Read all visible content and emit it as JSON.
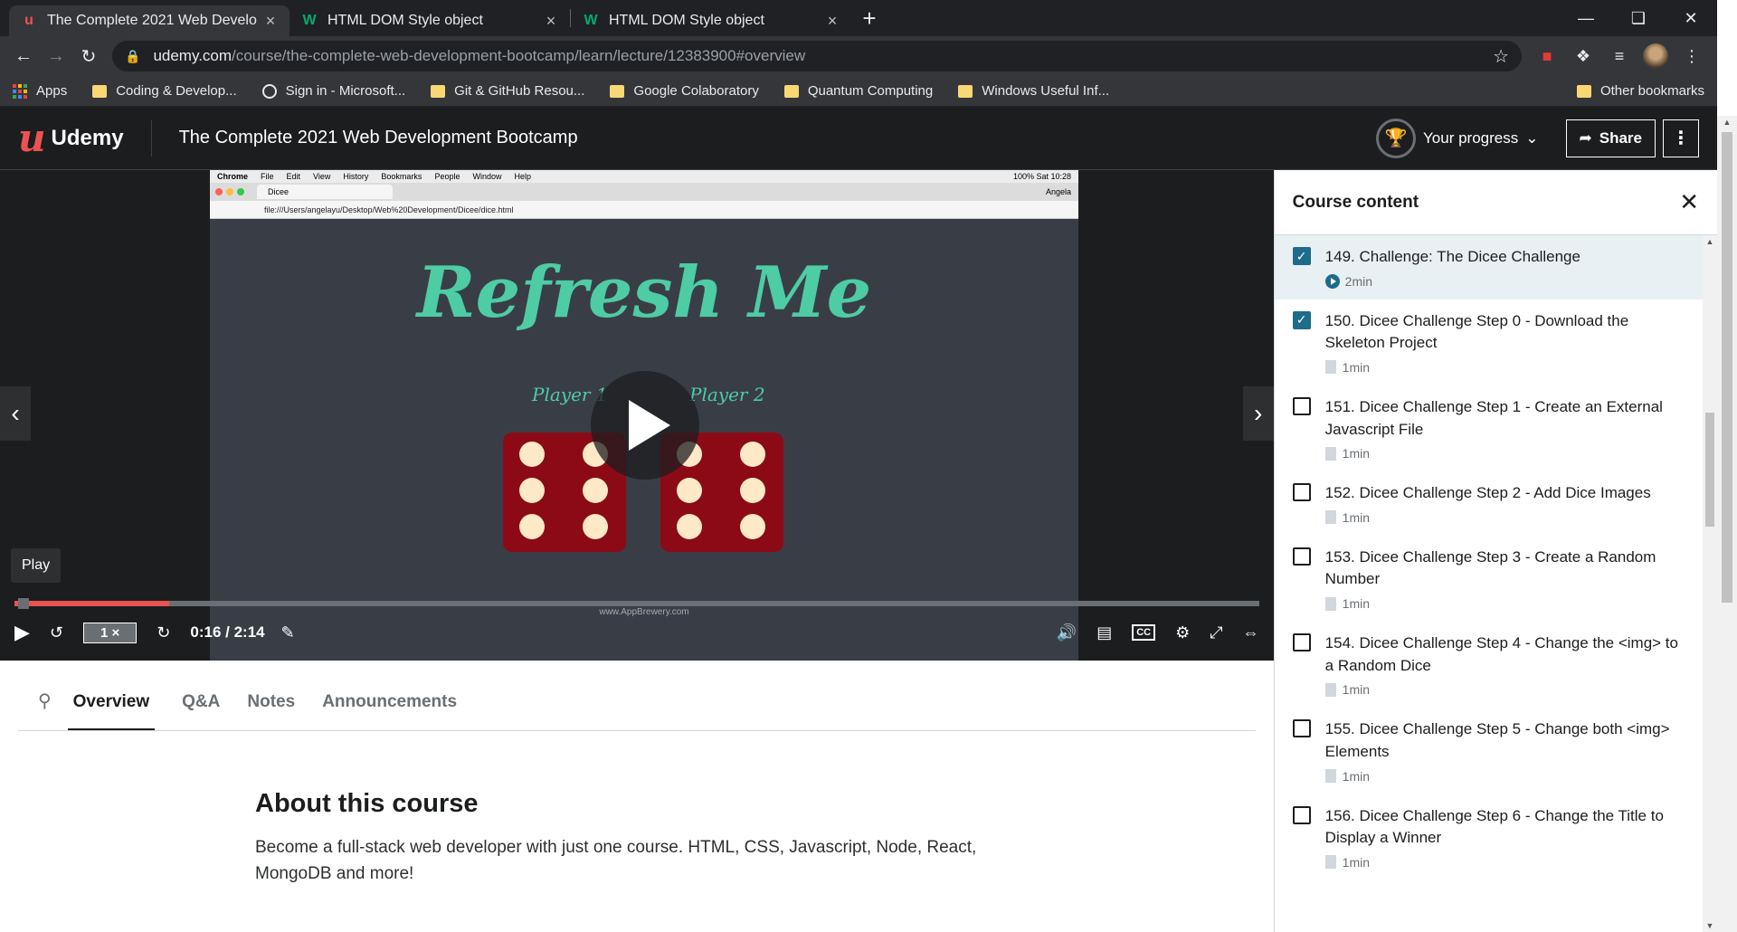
{
  "browser": {
    "tabs": [
      {
        "label": "The Complete 2021 Web Develo",
        "active": true
      },
      {
        "label": "HTML DOM Style object",
        "active": false
      },
      {
        "label": "HTML DOM Style object",
        "active": false
      }
    ],
    "url_host": "udemy.com",
    "url_path": "/course/the-complete-web-development-bootcamp/learn/lecture/12383900#overview",
    "bookmarks": [
      "Apps",
      "Coding & Develop...",
      "Sign in - Microsoft...",
      "Git & GitHub Resou...",
      "Google Colaboratory",
      "Quantum Computing",
      "Windows Useful Inf..."
    ],
    "other_bookmarks": "Other bookmarks"
  },
  "header": {
    "logo": "Udemy",
    "course_title": "The Complete 2021 Web Development Bootcamp",
    "progress_label": "Your progress",
    "share_label": "Share"
  },
  "video": {
    "heading": "Refresh Me",
    "player1": "Player 1",
    "player2": "Player 2",
    "tooltip": "Play",
    "speed": "1 ×",
    "time": "0:16 / 2:14",
    "progress_fraction": 0.124,
    "watermark": "www.AppBrewery.com",
    "mac_url": "file:///Users/angelayu/Desktop/Web%20Development/Dicee/dice.html",
    "mac_tab": "Dicee",
    "mac_user": "Angela",
    "mac_menu": [
      "Chrome",
      "File",
      "Edit",
      "View",
      "History",
      "Bookmarks",
      "People",
      "Window",
      "Help"
    ],
    "mac_status": "100%   Sat 10:28"
  },
  "course_tabs": [
    "Overview",
    "Q&A",
    "Notes",
    "Announcements"
  ],
  "about": {
    "heading": "About this course",
    "text": "Become a full-stack web developer with just one course. HTML, CSS, Javascript, Node, React, MongoDB and more!"
  },
  "sidebar": {
    "title": "Course content",
    "lessons": [
      {
        "title": "149. Challenge: The Dicee Challenge",
        "duration": "2min",
        "checked": true,
        "type": "video",
        "current": true
      },
      {
        "title": "150. Dicee Challenge Step 0 - Download the Skeleton Project",
        "duration": "1min",
        "checked": true,
        "type": "article"
      },
      {
        "title": "151. Dicee Challenge Step 1 - Create an External Javascript File",
        "duration": "1min",
        "checked": false,
        "type": "article"
      },
      {
        "title": "152. Dicee Challenge Step 2 - Add Dice Images",
        "duration": "1min",
        "checked": false,
        "type": "article"
      },
      {
        "title": "153. Dicee Challenge Step 3 - Create a Random Number",
        "duration": "1min",
        "checked": false,
        "type": "article"
      },
      {
        "title": "154. Dicee Challenge Step 4 - Change the <img> to a Random Dice",
        "duration": "1min",
        "checked": false,
        "type": "article"
      },
      {
        "title": "155. Dicee Challenge Step 5 - Change both <img> Elements",
        "duration": "1min",
        "checked": false,
        "type": "article"
      },
      {
        "title": "156. Dicee Challenge Step 6 - Change the Title to Display a Winner",
        "duration": "1min",
        "checked": false,
        "type": "article"
      }
    ]
  }
}
